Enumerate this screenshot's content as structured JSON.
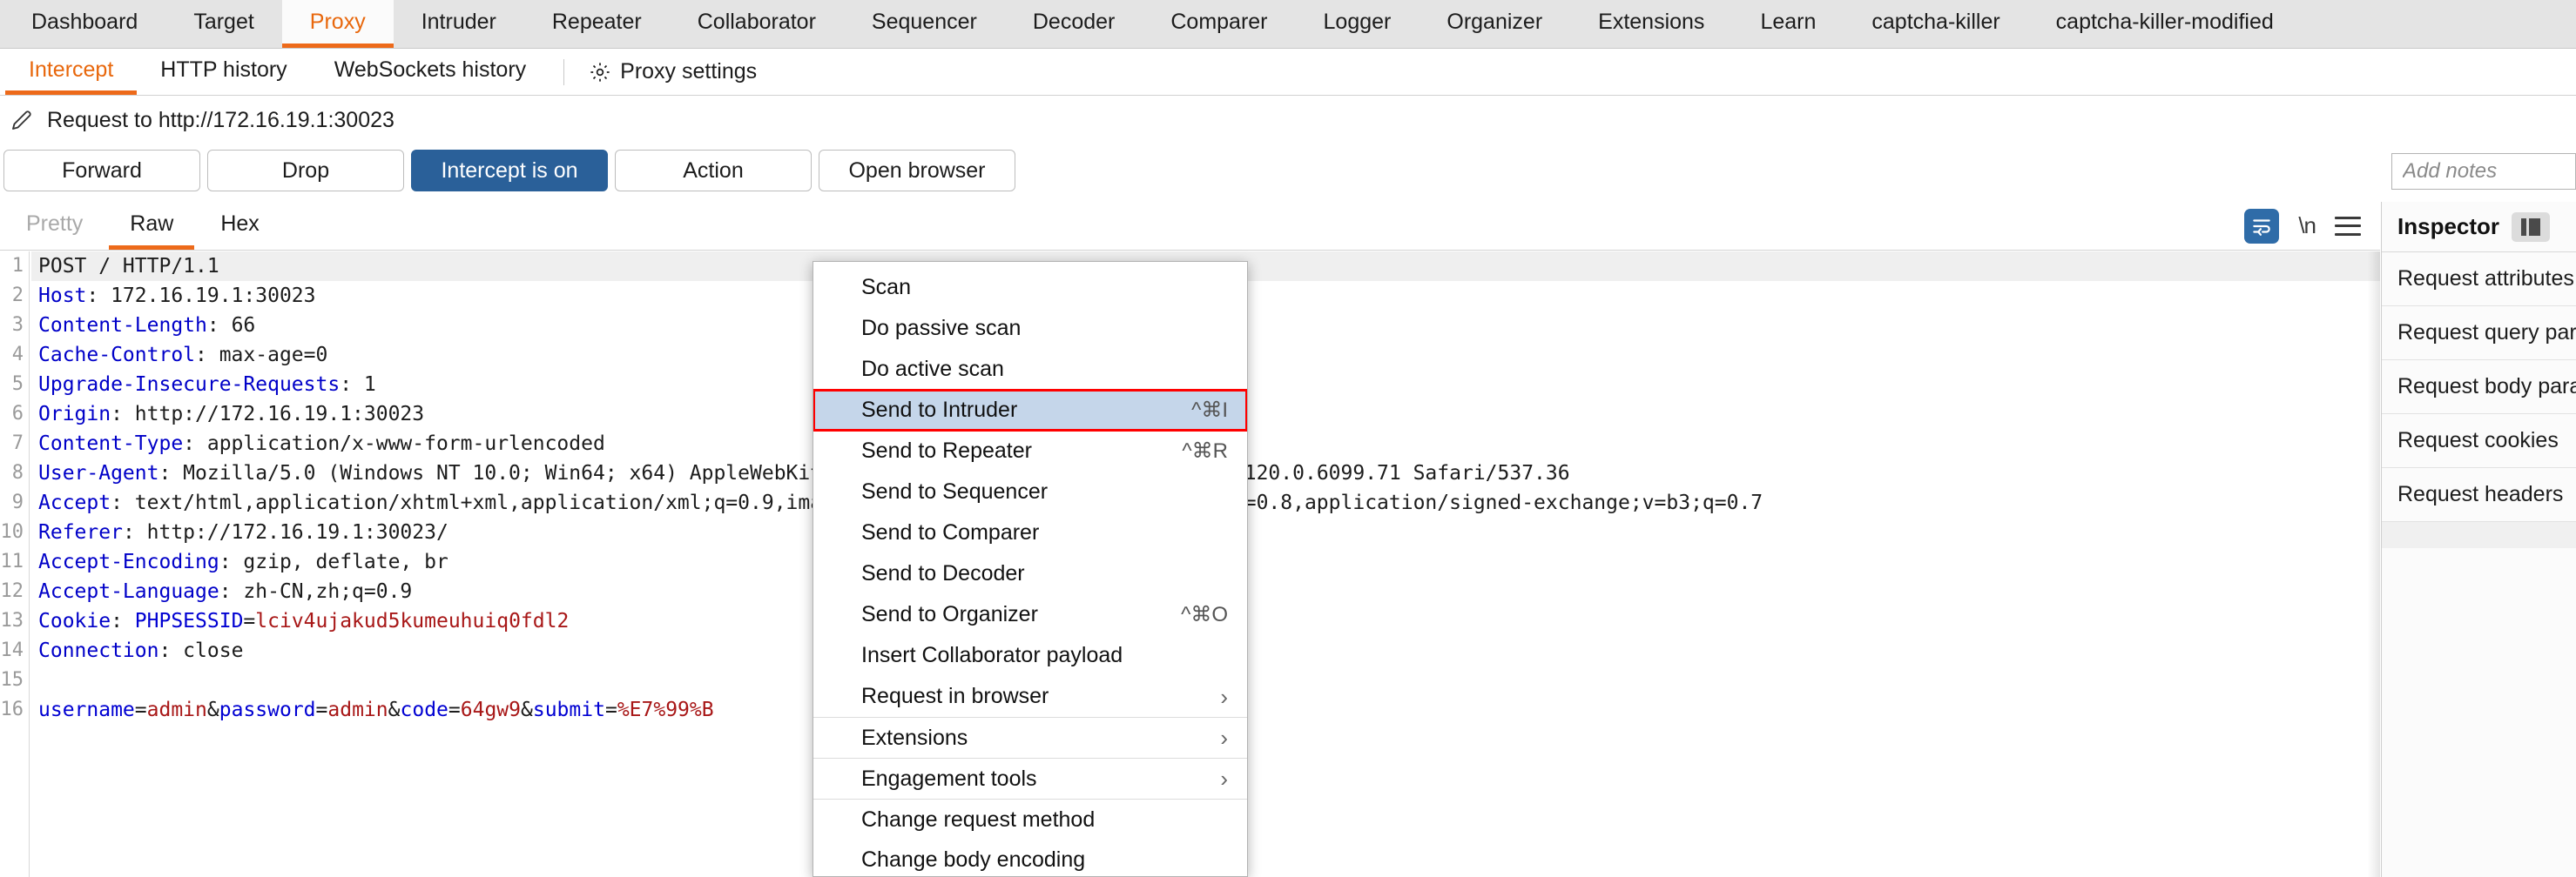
{
  "main_tabs": [
    {
      "label": "Dashboard",
      "active": false
    },
    {
      "label": "Target",
      "active": false
    },
    {
      "label": "Proxy",
      "active": true
    },
    {
      "label": "Intruder",
      "active": false
    },
    {
      "label": "Repeater",
      "active": false
    },
    {
      "label": "Collaborator",
      "active": false
    },
    {
      "label": "Sequencer",
      "active": false
    },
    {
      "label": "Decoder",
      "active": false
    },
    {
      "label": "Comparer",
      "active": false
    },
    {
      "label": "Logger",
      "active": false
    },
    {
      "label": "Organizer",
      "active": false
    },
    {
      "label": "Extensions",
      "active": false
    },
    {
      "label": "Learn",
      "active": false
    },
    {
      "label": "captcha-killer",
      "active": false
    },
    {
      "label": "captcha-killer-modified",
      "active": false
    }
  ],
  "sub_tabs": [
    {
      "label": "Intercept",
      "active": true
    },
    {
      "label": "HTTP history",
      "active": false
    },
    {
      "label": "WebSockets history",
      "active": false
    }
  ],
  "proxy_settings": {
    "label": "Proxy settings",
    "icon": "gear-icon"
  },
  "request_header": {
    "icon": "pencil-icon",
    "title": "Request to http://172.16.19.1:30023"
  },
  "actions": {
    "forward": "Forward",
    "drop": "Drop",
    "intercept": "Intercept is on",
    "action": "Action",
    "open_browser": "Open browser",
    "notes_placeholder": "Add notes",
    "notes_value": ""
  },
  "editor_tabs": [
    {
      "label": "Pretty",
      "state": "disabled"
    },
    {
      "label": "Raw",
      "state": "active"
    },
    {
      "label": "Hex",
      "state": "normal"
    }
  ],
  "editor_tools": {
    "wrap_icon": "word-wrap-icon",
    "newline_label": "\\n",
    "menu_icon": "hamburger-menu-icon"
  },
  "request_lines": [
    {
      "n": 1,
      "highlight": true,
      "parts": [
        {
          "t": "POST / HTTP/1.1",
          "c": "v"
        }
      ]
    },
    {
      "n": 2,
      "highlight": false,
      "parts": [
        {
          "t": "Host",
          "c": "k"
        },
        {
          "t": ": 172.16.19.1:30023",
          "c": "v"
        }
      ]
    },
    {
      "n": 3,
      "highlight": false,
      "parts": [
        {
          "t": "Content-Length",
          "c": "k"
        },
        {
          "t": ": 66",
          "c": "v"
        }
      ]
    },
    {
      "n": 4,
      "highlight": false,
      "parts": [
        {
          "t": "Cache-Control",
          "c": "k"
        },
        {
          "t": ": max-age=0",
          "c": "v"
        }
      ]
    },
    {
      "n": 5,
      "highlight": false,
      "parts": [
        {
          "t": "Upgrade-Insecure-Requests",
          "c": "k"
        },
        {
          "t": ": 1",
          "c": "v"
        }
      ]
    },
    {
      "n": 6,
      "highlight": false,
      "parts": [
        {
          "t": "Origin",
          "c": "k"
        },
        {
          "t": ": http://172.16.19.1:30023",
          "c": "v"
        }
      ]
    },
    {
      "n": 7,
      "highlight": false,
      "parts": [
        {
          "t": "Content-Type",
          "c": "k"
        },
        {
          "t": ": application/x-www-form-urlencoded",
          "c": "v"
        }
      ]
    },
    {
      "n": 8,
      "highlight": false,
      "parts": [
        {
          "t": "User-Agent",
          "c": "k"
        },
        {
          "t": ": Mozilla/5.0 (Windows NT 10.0; Win64; x64) AppleWebKit/537.36 (KHTML, like Gecko) Chrome/120.0.6099.71 Safari/537.36",
          "c": "v"
        }
      ]
    },
    {
      "n": 9,
      "highlight": false,
      "parts": [
        {
          "t": "Accept",
          "c": "k"
        },
        {
          "t": ": text/html,application/xhtml+xml,application/xml;q=0.9,image/avif,image/webp,image/apng,*/*;q=0.8,application/signed-exchange;v=b3;q=0.7",
          "c": "v"
        }
      ]
    },
    {
      "n": 10,
      "highlight": false,
      "parts": [
        {
          "t": "Referer",
          "c": "k"
        },
        {
          "t": ": http://172.16.19.1:30023/",
          "c": "v"
        }
      ]
    },
    {
      "n": 11,
      "highlight": false,
      "parts": [
        {
          "t": "Accept-Encoding",
          "c": "k"
        },
        {
          "t": ": gzip, deflate, br",
          "c": "v"
        }
      ]
    },
    {
      "n": 12,
      "highlight": false,
      "parts": [
        {
          "t": "Accept-Language",
          "c": "k"
        },
        {
          "t": ": zh-CN,zh;q=0.9",
          "c": "v"
        }
      ]
    },
    {
      "n": 13,
      "highlight": false,
      "parts": [
        {
          "t": "Cookie",
          "c": "k"
        },
        {
          "t": ": ",
          "c": "v"
        },
        {
          "t": "PHPSESSID",
          "c": "b"
        },
        {
          "t": "=",
          "c": "v"
        },
        {
          "t": "lciv4ujakud5kumeuhuiq0fdl2",
          "c": "r"
        }
      ]
    },
    {
      "n": 14,
      "highlight": false,
      "parts": [
        {
          "t": "Connection",
          "c": "k"
        },
        {
          "t": ": close",
          "c": "v"
        }
      ]
    },
    {
      "n": 15,
      "highlight": false,
      "parts": [
        {
          "t": "",
          "c": "v"
        }
      ]
    },
    {
      "n": 16,
      "highlight": false,
      "parts": [
        {
          "t": "username",
          "c": "b"
        },
        {
          "t": "=",
          "c": "v"
        },
        {
          "t": "admin",
          "c": "r"
        },
        {
          "t": "&",
          "c": "v"
        },
        {
          "t": "password",
          "c": "b"
        },
        {
          "t": "=",
          "c": "v"
        },
        {
          "t": "admin",
          "c": "r"
        },
        {
          "t": "&",
          "c": "v"
        },
        {
          "t": "code",
          "c": "b"
        },
        {
          "t": "=",
          "c": "v"
        },
        {
          "t": "64gw9",
          "c": "r"
        },
        {
          "t": "&",
          "c": "v"
        },
        {
          "t": "submit",
          "c": "b"
        },
        {
          "t": "=",
          "c": "v"
        },
        {
          "t": "%E7%99%B",
          "c": "r"
        }
      ]
    }
  ],
  "context_menu": [
    {
      "label": "Scan",
      "accel": "",
      "arrow": false,
      "selected": false,
      "sep": false
    },
    {
      "label": "Do passive scan",
      "accel": "",
      "arrow": false,
      "selected": false,
      "sep": false
    },
    {
      "label": "Do active scan",
      "accel": "",
      "arrow": false,
      "selected": false,
      "sep": false
    },
    {
      "label": "Send to Intruder",
      "accel": "^⌘I",
      "arrow": false,
      "selected": true,
      "sep": false
    },
    {
      "label": "Send to Repeater",
      "accel": "^⌘R",
      "arrow": false,
      "selected": false,
      "sep": false
    },
    {
      "label": "Send to Sequencer",
      "accel": "",
      "arrow": false,
      "selected": false,
      "sep": false
    },
    {
      "label": "Send to Comparer",
      "accel": "",
      "arrow": false,
      "selected": false,
      "sep": false
    },
    {
      "label": "Send to Decoder",
      "accel": "",
      "arrow": false,
      "selected": false,
      "sep": false
    },
    {
      "label": "Send to Organizer",
      "accel": "^⌘O",
      "arrow": false,
      "selected": false,
      "sep": false
    },
    {
      "label": "Insert Collaborator payload",
      "accel": "",
      "arrow": false,
      "selected": false,
      "sep": false
    },
    {
      "label": "Request in browser",
      "accel": "",
      "arrow": true,
      "selected": false,
      "sep": false
    },
    {
      "label": "Extensions",
      "accel": "",
      "arrow": true,
      "selected": false,
      "sep": true
    },
    {
      "label": "Engagement tools",
      "accel": "",
      "arrow": true,
      "selected": false,
      "sep": true
    },
    {
      "label": "Change request method",
      "accel": "",
      "arrow": false,
      "selected": false,
      "sep": true
    },
    {
      "label": "Change body encoding",
      "accel": "",
      "arrow": false,
      "selected": false,
      "sep": false
    }
  ],
  "inspector": {
    "title": "Inspector",
    "collapse_icon": "collapse-panel-icon",
    "rows": [
      {
        "label": "Request attributes"
      },
      {
        "label": "Request query parameters"
      },
      {
        "label": "Request body parameters"
      },
      {
        "label": "Request cookies"
      },
      {
        "label": "Request headers"
      }
    ]
  },
  "colors": {
    "accent": "#ed6a1a",
    "primary_button": "#2a6099",
    "selection": "#c5d6ea",
    "selection_outline": "#ff0000"
  }
}
